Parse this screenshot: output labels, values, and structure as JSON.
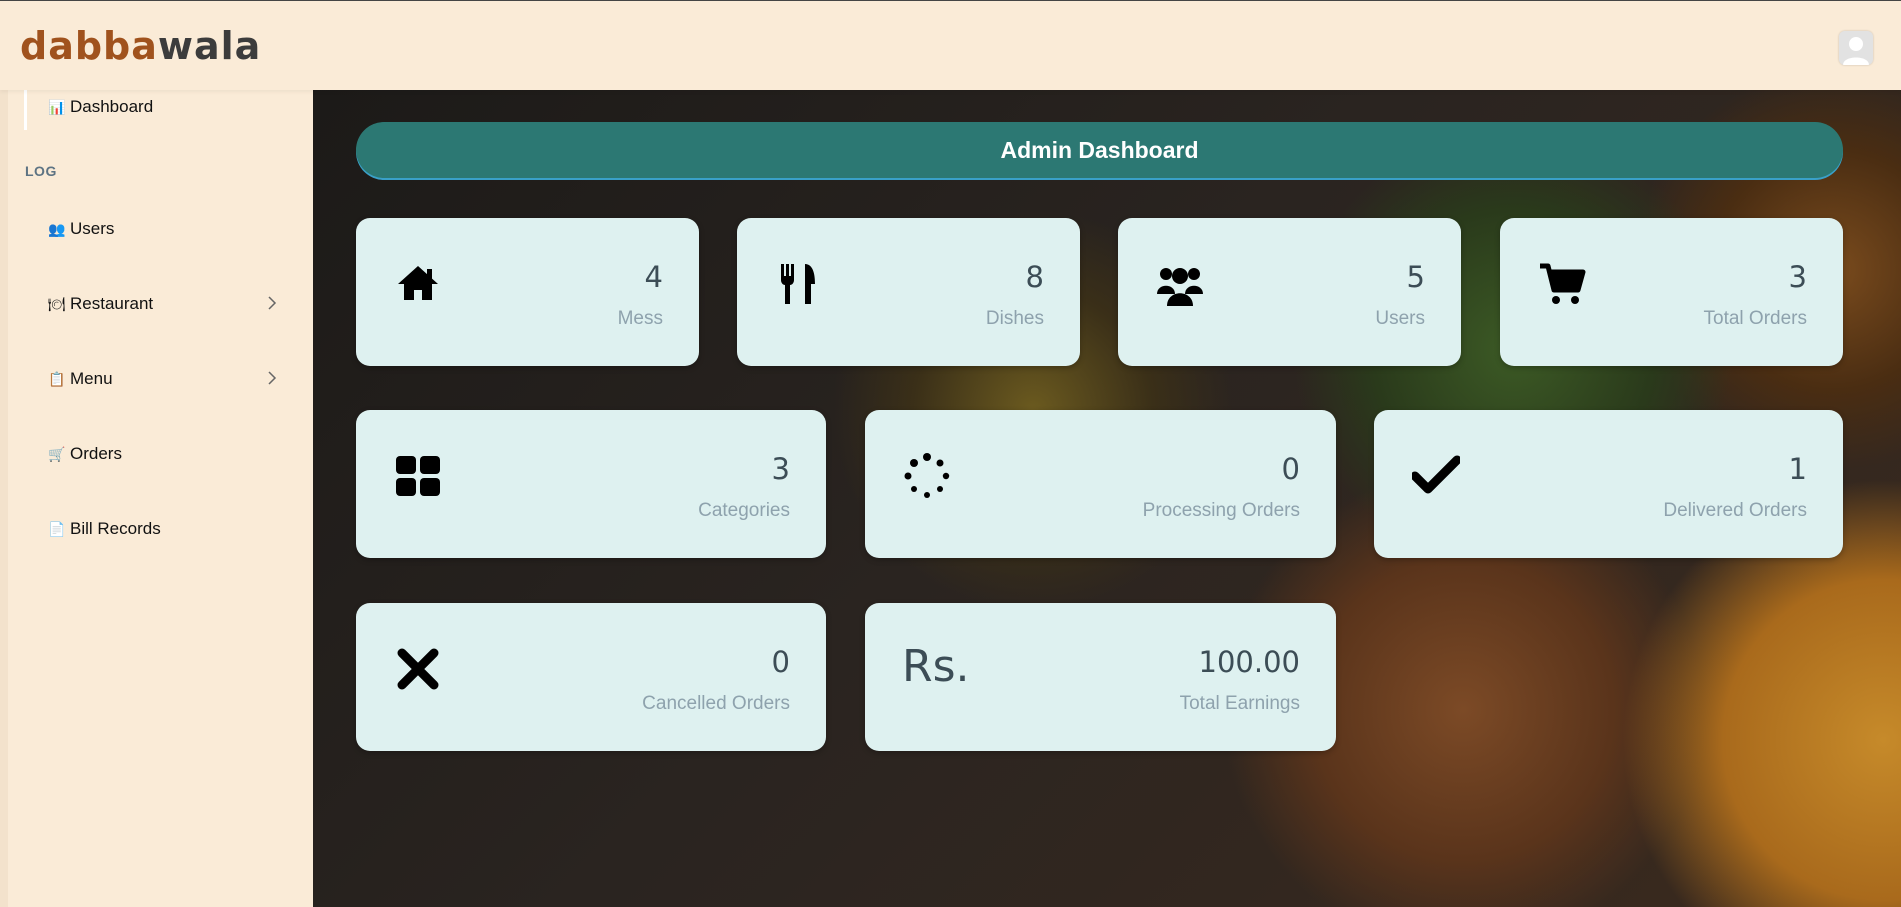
{
  "brand": {
    "part1": "dabba",
    "part2": "wala"
  },
  "sidebar": {
    "section_label": "LOG",
    "items": [
      {
        "label": "Dashboard",
        "icon": "bar-chart-icon",
        "glyph": "📊",
        "has_chevron": false
      },
      {
        "label": "Users",
        "icon": "users-icon",
        "glyph": "👥",
        "has_chevron": false
      },
      {
        "label": "Restaurant",
        "icon": "plate-icon",
        "glyph": "🍽",
        "has_chevron": true
      },
      {
        "label": "Menu",
        "icon": "clipboard-icon",
        "glyph": "📋",
        "has_chevron": true
      },
      {
        "label": "Orders",
        "icon": "cart-icon",
        "glyph": "🛒",
        "has_chevron": false
      },
      {
        "label": "Bill Records",
        "icon": "document-icon",
        "glyph": "📄",
        "has_chevron": false
      }
    ]
  },
  "main": {
    "title": "Admin Dashboard",
    "stats": [
      {
        "value": "4",
        "label": "Mess",
        "icon": "home-icon"
      },
      {
        "value": "8",
        "label": "Dishes",
        "icon": "utensils-icon"
      },
      {
        "value": "5",
        "label": "Users",
        "icon": "users-icon"
      },
      {
        "value": "3",
        "label": "Total Orders",
        "icon": "cart-icon"
      },
      {
        "value": "3",
        "label": "Categories",
        "icon": "grid-icon"
      },
      {
        "value": "0",
        "label": "Processing Orders",
        "icon": "spinner-icon"
      },
      {
        "value": "1",
        "label": "Delivered Orders",
        "icon": "check-icon"
      },
      {
        "value": "0",
        "label": "Cancelled Orders",
        "icon": "x-icon"
      },
      {
        "value": "100.00",
        "label": "Total Earnings",
        "icon": "rupee-icon",
        "icon_text": "Rs."
      }
    ]
  },
  "colors": {
    "banner": "#2c7873",
    "card": "#def1f0",
    "sidebar": "#faebd7"
  }
}
